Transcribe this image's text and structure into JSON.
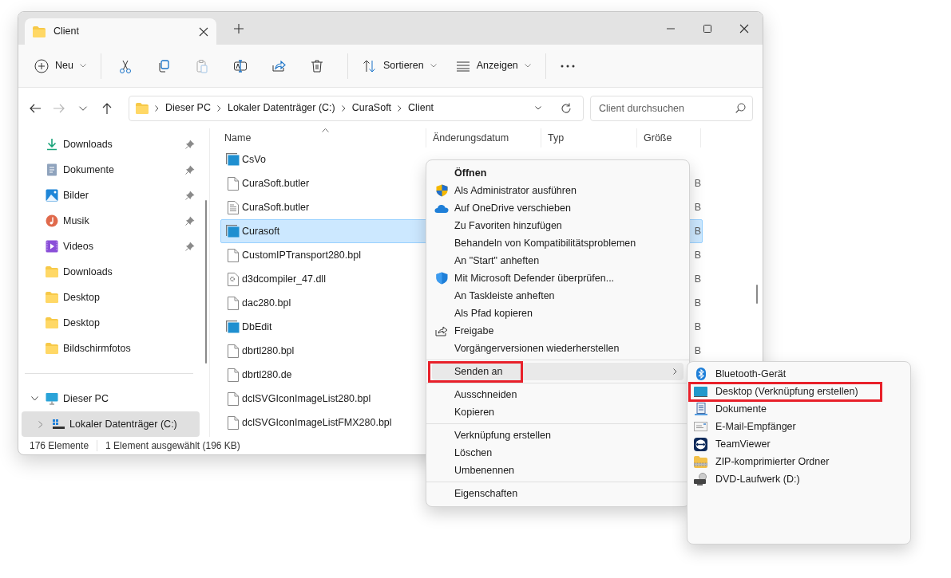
{
  "window": {
    "tab_title": "Client"
  },
  "toolbar": {
    "new_button": "Neu",
    "icon_buttons": [
      {
        "disabled": false
      },
      {
        "disabled": false
      },
      {
        "disabled": true
      },
      {
        "disabled": false
      },
      {
        "disabled": false
      },
      {
        "disabled": false
      }
    ],
    "sort_button": "Sortieren",
    "view_button": "Anzeigen"
  },
  "nav_buttons": [
    {
      "disabled": false
    },
    {
      "disabled": true
    },
    {
      "disabled": false
    },
    {
      "disabled": false
    }
  ],
  "address": {
    "breadcrumbs": [
      "Dieser PC",
      "Lokaler Datenträger (C:)",
      "CuraSoft",
      "Client"
    ]
  },
  "search": {
    "placeholder": "Client durchsuchen"
  },
  "sidebar": {
    "items": [
      {
        "label": "Downloads",
        "pinned": true,
        "selected": false
      },
      {
        "label": "Dokumente",
        "pinned": true,
        "selected": false
      },
      {
        "label": "Bilder",
        "pinned": true,
        "selected": false
      },
      {
        "label": "Musik",
        "pinned": true,
        "selected": false
      },
      {
        "label": "Videos",
        "pinned": true,
        "selected": false
      },
      {
        "label": "Downloads",
        "pinned": false,
        "selected": false
      },
      {
        "label": "Desktop",
        "pinned": false,
        "selected": false
      },
      {
        "label": "Desktop",
        "pinned": false,
        "selected": false
      },
      {
        "label": "Bildschirmfotos",
        "pinned": false,
        "selected": false
      }
    ],
    "tree": [
      {
        "label": "Dieser PC",
        "expanded": true,
        "selected": false,
        "children": [
          {
            "label": "Lokaler Datenträger (C:)",
            "expanded": false,
            "selected": true
          }
        ]
      }
    ]
  },
  "table": {
    "columns": [
      {
        "label": "Name",
        "sorted": true
      },
      {
        "label": "Änderungsdatum",
        "sorted": false
      },
      {
        "label": "Typ",
        "sorted": false
      },
      {
        "label": "Größe",
        "sorted": false
      }
    ],
    "rows": [
      {
        "kind": "app",
        "name": "CsVo",
        "selected": false
      },
      {
        "kind": "file",
        "name": "CuraSoft.butler",
        "size": "B",
        "selected": false
      },
      {
        "kind": "text",
        "name": "CuraSoft.butler",
        "size": "B",
        "selected": false
      },
      {
        "kind": "app",
        "name": "Curasoft",
        "size": "B",
        "selected": true
      },
      {
        "kind": "file",
        "name": "CustomIPTransport280.bpl",
        "size": "B",
        "selected": false
      },
      {
        "kind": "dll",
        "name": "d3dcompiler_47.dll",
        "size": "B",
        "selected": false
      },
      {
        "kind": "file",
        "name": "dac280.bpl",
        "size": "B",
        "selected": false
      },
      {
        "kind": "app",
        "name": "DbEdit",
        "size": "B",
        "selected": false
      },
      {
        "kind": "file",
        "name": "dbrtl280.bpl",
        "size": "B",
        "selected": false
      },
      {
        "kind": "file",
        "name": "dbrtl280.de",
        "selected": false
      },
      {
        "kind": "file",
        "name": "dclSVGIconImageList280.bpl",
        "selected": false
      },
      {
        "kind": "file",
        "name": "dclSVGIconImageListFMX280.bpl",
        "selected": false
      }
    ]
  },
  "status_bar": {
    "count": "176 Elemente",
    "selection": "1 Element ausgewählt (196 KB)"
  },
  "context_menu": {
    "items": [
      {
        "kind": "item",
        "label": "Öffnen",
        "default": true,
        "highlighted": false,
        "annotated": false
      },
      {
        "kind": "item",
        "label": "Als Administrator ausführen",
        "default": false,
        "highlighted": false,
        "annotated": false
      },
      {
        "kind": "item",
        "label": "Auf OneDrive verschieben",
        "default": false,
        "highlighted": false,
        "annotated": false
      },
      {
        "kind": "item",
        "label": "Zu Favoriten hinzufügen",
        "default": false,
        "highlighted": false,
        "annotated": false
      },
      {
        "kind": "item",
        "label": "Behandeln von Kompatibilitätsproblemen",
        "default": false,
        "highlighted": false,
        "annotated": false
      },
      {
        "kind": "item",
        "label": "An \"Start\" anheften",
        "default": false,
        "highlighted": false,
        "annotated": false
      },
      {
        "kind": "item",
        "label": "Mit Microsoft Defender überprüfen...",
        "default": false,
        "highlighted": false,
        "annotated": false
      },
      {
        "kind": "item",
        "label": "An Taskleiste anheften",
        "default": false,
        "highlighted": false,
        "annotated": false
      },
      {
        "kind": "item",
        "label": "Als Pfad kopieren",
        "default": false,
        "highlighted": false,
        "annotated": false
      },
      {
        "kind": "item",
        "label": "Freigabe",
        "default": false,
        "highlighted": false,
        "annotated": false
      },
      {
        "kind": "item",
        "label": "Vorgängerversionen wiederherstellen",
        "default": false,
        "highlighted": false,
        "annotated": false
      },
      {
        "kind": "separator"
      },
      {
        "kind": "submenu",
        "label": "Senden an",
        "default": false,
        "highlighted": true,
        "annotated": true
      },
      {
        "kind": "separator"
      },
      {
        "kind": "item",
        "label": "Ausschneiden",
        "default": false,
        "highlighted": false,
        "annotated": false
      },
      {
        "kind": "item",
        "label": "Kopieren",
        "default": false,
        "highlighted": false,
        "annotated": false
      },
      {
        "kind": "separator"
      },
      {
        "kind": "item",
        "label": "Verknüpfung erstellen",
        "default": false,
        "highlighted": false,
        "annotated": false
      },
      {
        "kind": "item",
        "label": "Löschen",
        "default": false,
        "highlighted": false,
        "annotated": false
      },
      {
        "kind": "item",
        "label": "Umbenennen",
        "default": false,
        "highlighted": false,
        "annotated": false
      },
      {
        "kind": "separator"
      },
      {
        "kind": "item",
        "label": "Eigenschaften",
        "default": false,
        "highlighted": false,
        "annotated": false
      }
    ]
  },
  "submenu": {
    "items": [
      {
        "label": "Bluetooth-Gerät",
        "annotated": false
      },
      {
        "label": "Desktop (Verknüpfung erstellen)",
        "annotated": true
      },
      {
        "label": "Dokumente",
        "annotated": false
      },
      {
        "label": "E-Mail-Empfänger",
        "annotated": false
      },
      {
        "label": "TeamViewer",
        "annotated": false
      },
      {
        "label": "ZIP-komprimierter Ordner",
        "annotated": false
      },
      {
        "label": "DVD-Laufwerk (D:)",
        "annotated": false
      }
    ]
  }
}
